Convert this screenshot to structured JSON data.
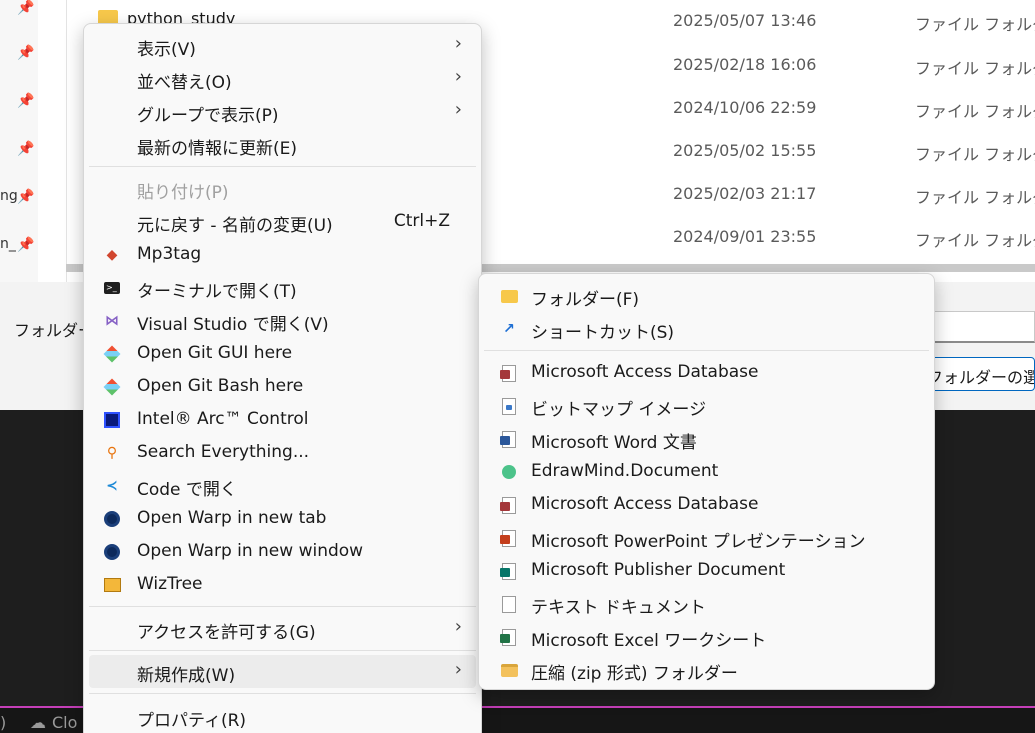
{
  "explorer": {
    "nav_cut_labels": [
      "ng",
      "n_"
    ],
    "files": [
      {
        "name": "python_study",
        "date": "2025/05/07 13:46",
        "type": "ファイル フォルダー"
      },
      {
        "name": "",
        "date": "2025/02/18 16:06",
        "type": "ファイル フォルダー"
      },
      {
        "name": "",
        "date": "2024/10/06 22:59",
        "type": "ファイル フォルダー"
      },
      {
        "name": "",
        "date": "2025/05/02 15:55",
        "type": "ファイル フォルダー"
      },
      {
        "name": "",
        "date": "2025/02/03 21:17",
        "type": "ファイル フォルダー"
      },
      {
        "name": "",
        "date": "2024/09/01 23:55",
        "type": "ファイル フォルダー"
      }
    ],
    "folder_label": "フォルダー:",
    "folder_input_value": "",
    "select_folder_button": "フォルダーの選択"
  },
  "terminal": {
    "status_left": ")",
    "status_cloud": "Clo"
  },
  "context_menu": {
    "items": [
      {
        "label": "表示(V)",
        "submenu": true
      },
      {
        "label": "並べ替え(O)",
        "submenu": true
      },
      {
        "label": "グループで表示(P)",
        "submenu": true
      },
      {
        "label": "最新の情報に更新(E)"
      },
      {
        "label": "貼り付け(P)",
        "disabled": true
      },
      {
        "label": "元に戻す - 名前の変更(U)",
        "shortcut": "Ctrl+Z"
      },
      {
        "label": "Mp3tag",
        "icon": "mp3tag-icon"
      },
      {
        "label": "ターミナルで開く(T)",
        "icon": "terminal-icon"
      },
      {
        "label": "Visual Studio で開く(V)",
        "icon": "visual-studio-icon"
      },
      {
        "label": "Open Git GUI here",
        "icon": "git-gui-icon"
      },
      {
        "label": "Open Git Bash here",
        "icon": "git-bash-icon"
      },
      {
        "label": "Intel® Arc™ Control",
        "icon": "intel-arc-icon"
      },
      {
        "label": "Search Everything...",
        "icon": "everything-search-icon"
      },
      {
        "label": "Code で開く",
        "icon": "vscode-icon"
      },
      {
        "label": "Open Warp in new tab",
        "icon": "warp-icon"
      },
      {
        "label": "Open Warp in new window",
        "icon": "warp-icon"
      },
      {
        "label": "WizTree",
        "icon": "wiztree-icon"
      },
      {
        "label": "アクセスを許可する(G)",
        "submenu": true
      },
      {
        "label": "新規作成(W)",
        "submenu": true,
        "highlighted": true
      },
      {
        "label": "プロパティ(R)"
      }
    ]
  },
  "new_submenu": {
    "items": [
      {
        "label": "フォルダー(F)",
        "icon": "folder-icon"
      },
      {
        "label": "ショートカット(S)",
        "icon": "shortcut-icon"
      },
      {
        "label": "Microsoft Access Database",
        "icon": "access-icon"
      },
      {
        "label": "ビットマップ イメージ",
        "icon": "bitmap-icon"
      },
      {
        "label": "Microsoft Word 文書",
        "icon": "word-icon"
      },
      {
        "label": "EdrawMind.Document",
        "icon": "edrawmind-icon"
      },
      {
        "label": "Microsoft Access Database",
        "icon": "access-icon"
      },
      {
        "label": "Microsoft PowerPoint プレゼンテーション",
        "icon": "powerpoint-icon"
      },
      {
        "label": "Microsoft Publisher Document",
        "icon": "publisher-icon"
      },
      {
        "label": "テキスト ドキュメント",
        "icon": "text-document-icon"
      },
      {
        "label": "Microsoft Excel ワークシート",
        "icon": "excel-icon"
      },
      {
        "label": "圧縮 (zip 形式) フォルダー",
        "icon": "zip-folder-icon"
      }
    ]
  },
  "colors": {
    "accent": "#0067c0",
    "terminal_border": "#c53fb9",
    "access": "#a4373a",
    "word": "#2b579a",
    "powerpoint": "#c43e1c",
    "publisher": "#077568",
    "excel": "#217346"
  }
}
